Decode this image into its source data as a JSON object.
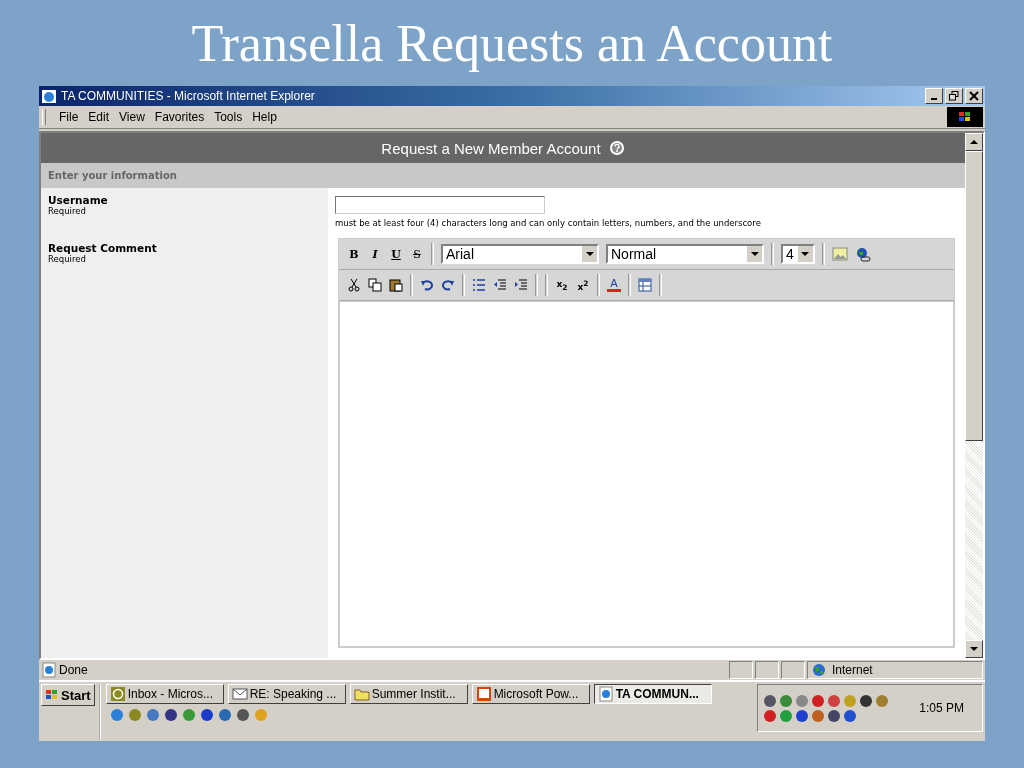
{
  "slide_title": "Transella Requests an Account",
  "window": {
    "title": "TA COMMUNITIES - Microsoft Internet Explorer"
  },
  "menu": [
    "File",
    "Edit",
    "View",
    "Favorites",
    "Tools",
    "Help"
  ],
  "page": {
    "header": "Request a New Member Account",
    "section": "Enter your information",
    "fields": [
      {
        "label": "Username",
        "note": "Required",
        "kind": "text",
        "hint": "must be at least four (4) characters long and can only contain letters, numbers, and the underscore"
      },
      {
        "label": "Request Comment",
        "note": "Required",
        "kind": "editor"
      }
    ]
  },
  "editor": {
    "format_buttons": [
      {
        "label": "B",
        "kind": "bold"
      },
      {
        "label": "I",
        "kind": "italic"
      },
      {
        "label": "U",
        "kind": "underline"
      },
      {
        "label": "S",
        "kind": "strike"
      }
    ],
    "font": "Arial",
    "style": "Normal",
    "size": "4",
    "script_buttons": [
      "x$_{2}$",
      "x$^{2}$"
    ],
    "color_button": "A"
  },
  "status_bar": {
    "status": "Done",
    "zone": "Internet"
  },
  "taskbar": {
    "start": "Start",
    "tasks": [
      {
        "label": "Inbox - Micros...",
        "selected": false
      },
      {
        "label": "RE: Speaking ...",
        "selected": false
      },
      {
        "label": "Summer Instit...",
        "selected": false
      },
      {
        "label": "Microsoft Pow...",
        "selected": false
      },
      {
        "label": "TA COMMUN...",
        "selected": true
      }
    ],
    "clock": "1:05 PM"
  }
}
